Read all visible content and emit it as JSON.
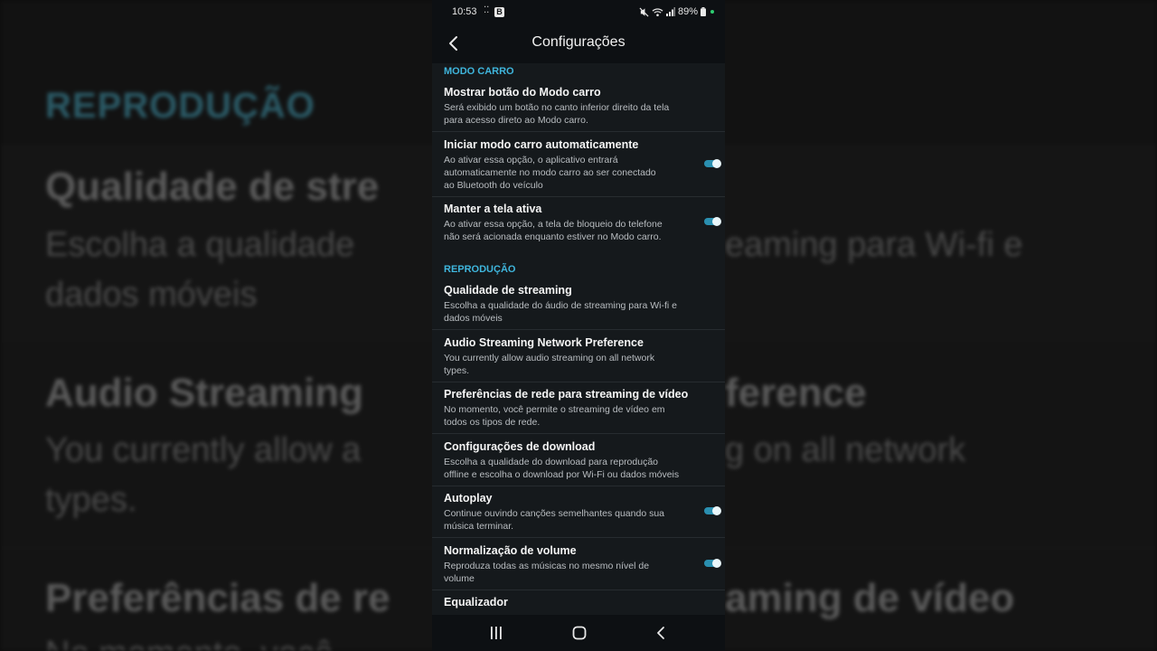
{
  "status_bar": {
    "time": "10:53",
    "indicator_dots": "⁚⁚",
    "b_badge": "B",
    "battery": "89%"
  },
  "app_bar": {
    "title": "Configurações"
  },
  "sections": [
    {
      "header": "MODO CARRO",
      "items": [
        {
          "title": "Mostrar botão do Modo carro",
          "desc": [
            "Será exibido um botão no canto inferior direito da tela",
            "para acesso direto ao Modo carro."
          ],
          "toggle": null
        },
        {
          "title": "Iniciar modo carro automaticamente",
          "desc": [
            "Ao ativar essa opção, o aplicativo entrará",
            "automaticamente no modo carro ao ser conectado",
            "ao Bluetooth do veículo"
          ],
          "toggle": true
        },
        {
          "title": "Manter a tela ativa",
          "desc": [
            "Ao ativar essa opção, a tela de bloqueio do telefone",
            "não será acionada enquanto estiver no Modo carro."
          ],
          "toggle": true
        }
      ]
    },
    {
      "header": "REPRODUÇÃO",
      "items": [
        {
          "title": "Qualidade de streaming",
          "desc": [
            "Escolha a qualidade do áudio de streaming para Wi-fi e",
            "dados móveis"
          ],
          "toggle": null
        },
        {
          "title": "Audio Streaming Network Preference",
          "desc": [
            "You currently allow audio streaming on all network",
            "types."
          ],
          "toggle": null
        },
        {
          "title": "Preferências de rede para streaming de vídeo",
          "desc": [
            "No momento, você permite o streaming de vídeo em",
            "todos os tipos de rede."
          ],
          "toggle": null
        },
        {
          "title": "Configurações de download",
          "desc": [
            "Escolha a qualidade do download para reprodução",
            "offline e escolha o download por Wi-Fi ou dados móveis"
          ],
          "toggle": null
        },
        {
          "title": "Autoplay",
          "desc": [
            "Continue ouvindo canções semelhantes quando sua",
            "música terminar."
          ],
          "toggle": true
        },
        {
          "title": "Normalização de volume",
          "desc": [
            "Reproduza todas as músicas no mesmo nível de",
            "volume"
          ],
          "toggle": true
        },
        {
          "title": "Equalizador",
          "desc": [],
          "toggle": null
        }
      ]
    }
  ],
  "background_zoom": {
    "header": "REPRODUÇÃO",
    "title1": "Qualidade de stre",
    "desc1a": "Escolha a qualidade",
    "desc1a_tail": "eaming para Wi-fi e",
    "desc1b": "dados móveis",
    "title2": "Audio Streaming",
    "title2_tail": "ference",
    "desc2a": "You currently allow a",
    "desc2a_tail": "g on all network",
    "desc2b": "types.",
    "title3": "Preferências de re",
    "title3_tail": "aming de vídeo",
    "desc3a": "No momento, você"
  },
  "nav": {
    "recents": "recents",
    "home": "home",
    "back": "back"
  },
  "colors": {
    "accent": "#3fb6dd",
    "toggle_track": "#2a8fb0",
    "background": "#15191c"
  }
}
